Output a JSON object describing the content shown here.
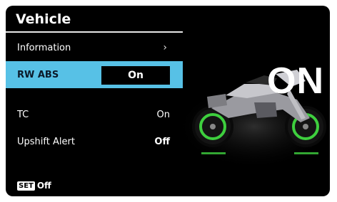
{
  "screen": {
    "title": "Vehicle",
    "menu": {
      "information": {
        "label": "Information",
        "chevron": "›"
      },
      "rw_abs": {
        "label": "RW ABS",
        "value": "On"
      },
      "tc": {
        "label": "TC",
        "value": "On"
      },
      "upshift_alert": {
        "label": "Upshift Alert",
        "value": "Off"
      }
    },
    "footer": {
      "set_badge": "SET",
      "text": "Off"
    },
    "preview": {
      "status_text": "ON"
    }
  },
  "colors": {
    "highlight": "#57c1e6",
    "background": "#000000",
    "wheel_accent": "#3ecf3e"
  },
  "icons": {
    "chevron": "chevron-right-icon",
    "preview": "motorcycle-illustration"
  }
}
